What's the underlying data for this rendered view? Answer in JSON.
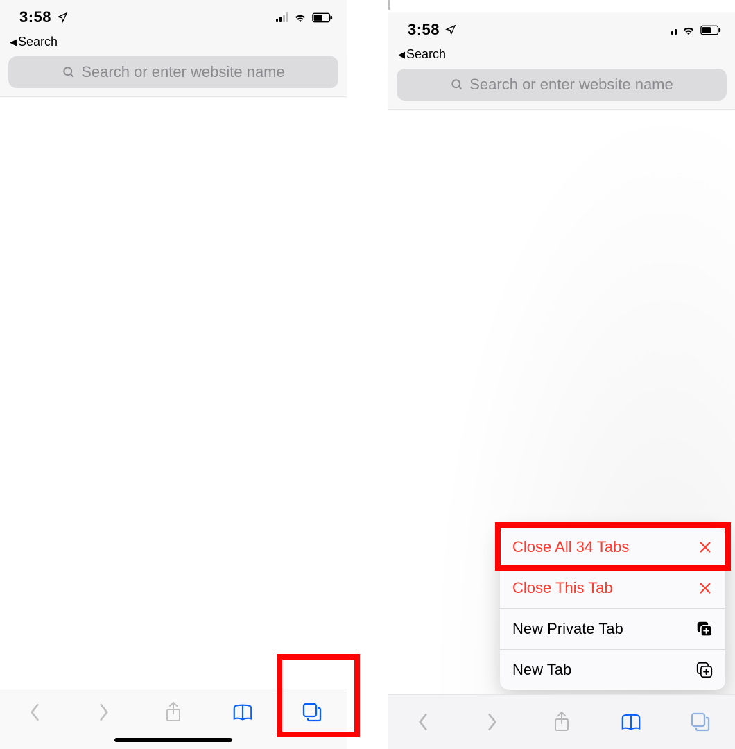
{
  "status": {
    "time": "3:58",
    "breadcrumb_label": "Search"
  },
  "urlbar": {
    "placeholder": "Search or enter website name"
  },
  "toolbar": {
    "back": "back",
    "forward": "forward",
    "share": "share",
    "bookmarks": "bookmarks",
    "tabs": "tabs"
  },
  "context_menu": {
    "close_all": "Close All 34 Tabs",
    "close_this": "Close This Tab",
    "new_private": "New Private Tab",
    "new_tab": "New Tab"
  }
}
